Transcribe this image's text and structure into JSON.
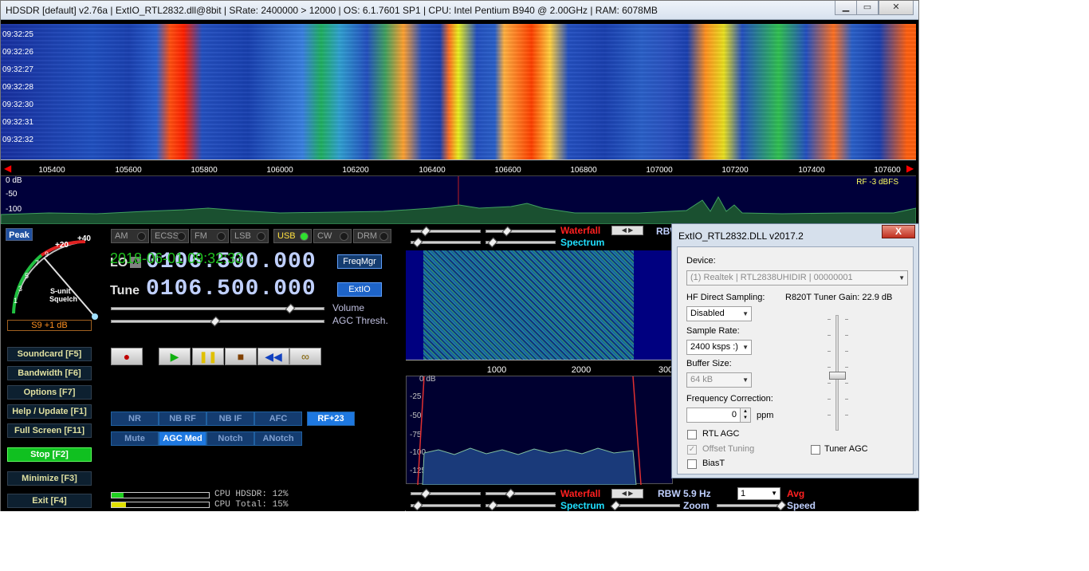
{
  "window": {
    "title": "HDSDR  [default]  v2.76a  |  ExtIO_RTL2832.dll@8bit  |  SRate: 2400000 > 12000  |  OS: 6.1.7601 SP1  |  CPU: Intel Pentium B940 @ 2.00GHz  |  RAM: 6078MB"
  },
  "waterfall": {
    "timestamps": [
      "09:32:25",
      "09:32:26",
      "09:32:27",
      "09:32:28",
      "09:32:30",
      "09:32:31",
      "09:32:32"
    ]
  },
  "freq_axis": {
    "ticks": [
      "105400",
      "105600",
      "105800",
      "106000",
      "106200",
      "106400",
      "106600",
      "106800",
      "107000",
      "107200",
      "107400",
      "107600"
    ]
  },
  "spectrum": {
    "levels": [
      "0 dB",
      "-50",
      "-100"
    ],
    "rf_label": "RF  -3 dBFS"
  },
  "smeter": {
    "peak_label": "Peak",
    "scale": [
      "+40",
      "+20",
      "9",
      "7",
      "5",
      "3",
      "1"
    ],
    "title1": "S-unit",
    "title2": "Squelch",
    "reading": "S9 +1 dB"
  },
  "modes": [
    {
      "label": "AM",
      "on": false
    },
    {
      "label": "ECSS",
      "on": false
    },
    {
      "label": "FM",
      "on": false
    },
    {
      "label": "LSB",
      "on": false
    },
    {
      "label": "USB",
      "on": true
    },
    {
      "label": "CW",
      "on": false
    },
    {
      "label": "DRM",
      "on": false
    }
  ],
  "lo": {
    "label": "LO",
    "lock": "A",
    "freq": "0106.500.000"
  },
  "tune": {
    "label": "Tune",
    "freq": "0106.500.000"
  },
  "buttons": {
    "freqmgr": "FreqMgr",
    "extio": "ExtIO"
  },
  "sliders": {
    "volume": "Volume",
    "agc": "AGC Thresh."
  },
  "side_menu": [
    {
      "label": "Soundcard  [F5]"
    },
    {
      "label": "Bandwidth  [F6]"
    },
    {
      "label": "Options    [F7]"
    },
    {
      "label": "Help / Update  [F1]"
    },
    {
      "label": "Full Screen  [F11]"
    },
    {
      "label": "Stop          [F2]"
    },
    {
      "label": "Minimize  [F3]"
    },
    {
      "label": "Exit         [F4]"
    }
  ],
  "dsp": {
    "row1": [
      "NR",
      "NB RF",
      "NB IF",
      "AFC"
    ],
    "rf_gain": "RF+23",
    "row2": [
      "Mute",
      "AGC Med",
      "Notch",
      "ANotch"
    ]
  },
  "clock": "2018-06-01 09:32:33",
  "cpu": {
    "hdsdr_label": "CPU HDSDR: 12%",
    "hdsdr_pct": 12,
    "total_label": "CPU Total: 15%",
    "total_pct": 15
  },
  "right": {
    "waterfall_label": "Waterfall",
    "spectrum_label": "Spectrum",
    "rbw_top": "RBW",
    "axis": [
      "1000",
      "2000",
      "300"
    ],
    "levels": [
      "0 dB",
      "-25",
      "-50",
      "-75",
      "-100",
      "-125"
    ],
    "rbw_bottom": "RBW  5.9 Hz",
    "avg_value": "1",
    "avg_label": "Avg",
    "zoom_label": "Zoom",
    "speed_label": "Speed"
  },
  "dialog": {
    "title": "ExtIO_RTL2832.DLL v2017.2",
    "close": "X",
    "device_label": "Device:",
    "device_value": "(1) Realtek | RTL2838UHIDIR | 00000001",
    "hf_label": "HF Direct Sampling:",
    "hf_value": "Disabled",
    "tuner_gain": "R820T Tuner Gain: 22.9  dB",
    "sr_label": "Sample Rate:",
    "sr_value": "2400 ksps :)",
    "buf_label": "Buffer Size:",
    "buf_value": "64 kB",
    "fc_label": "Frequency Correction:",
    "fc_value": "0",
    "fc_unit": "ppm",
    "rtl_agc": "RTL AGC",
    "offset": "Offset Tuning",
    "biast": "BiasT",
    "tuner_agc": "Tuner AGC"
  },
  "colors": {
    "accent": "#1e64c8",
    "clock": "#20c020",
    "waterfall_label": "#ff2020",
    "spectrum_label": "#20e0ff"
  }
}
